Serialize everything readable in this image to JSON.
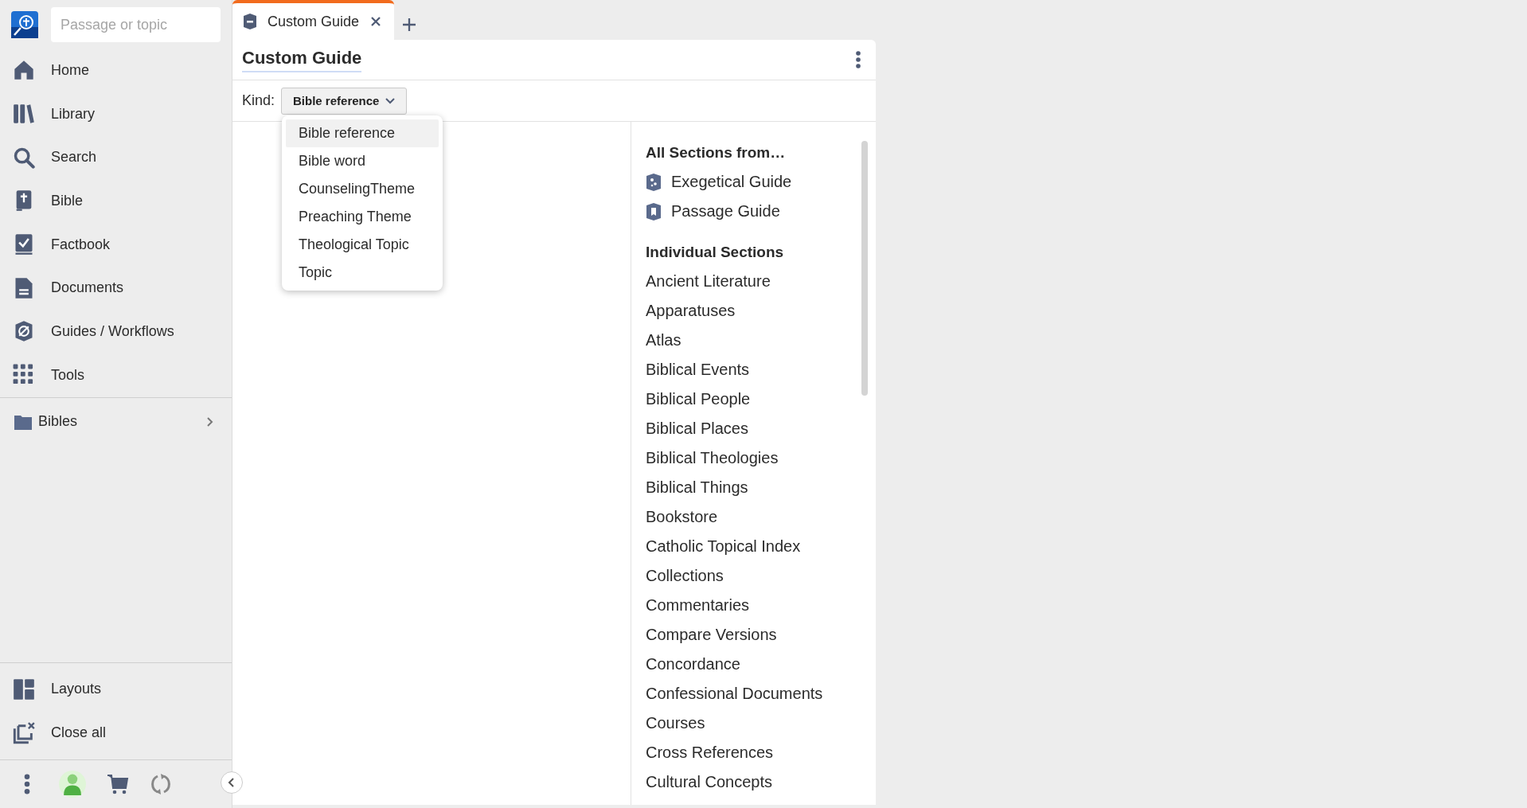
{
  "search": {
    "placeholder": "Passage or topic"
  },
  "nav": [
    {
      "label": "Home"
    },
    {
      "label": "Library"
    },
    {
      "label": "Search"
    },
    {
      "label": "Bible"
    },
    {
      "label": "Factbook"
    },
    {
      "label": "Documents"
    },
    {
      "label": "Guides / Workflows"
    },
    {
      "label": "Tools"
    }
  ],
  "folders": [
    {
      "label": "Bibles"
    }
  ],
  "bottom_nav": [
    {
      "label": "Layouts"
    },
    {
      "label": "Close all"
    }
  ],
  "tabs": [
    {
      "label": "Custom Guide",
      "selected": true
    }
  ],
  "panel": {
    "title": "Custom Guide",
    "kind_label": "Kind:",
    "kind_value": "Bible reference",
    "dropdown_expanded": true,
    "options": [
      {
        "label": "Bible reference",
        "selected": true
      },
      {
        "label": "Bible word",
        "selected": false
      },
      {
        "label": "CounselingTheme",
        "selected": false
      },
      {
        "label": "Preaching Theme",
        "selected": false
      },
      {
        "label": "Theological Topic",
        "selected": false
      },
      {
        "label": "Topic",
        "selected": false
      }
    ]
  },
  "sections": {
    "guides_heading": "All Sections from…",
    "guides": [
      "Exegetical Guide",
      "Passage Guide"
    ],
    "individual_heading": "Individual Sections",
    "items": [
      "Ancient Literature",
      "Apparatuses",
      "Atlas",
      "Biblical Events",
      "Biblical People",
      "Biblical Places",
      "Biblical Theologies",
      "Biblical Things",
      "Bookstore",
      "Catholic Topical Index",
      "Collections",
      "Commentaries",
      "Compare Versions",
      "Concordance",
      "Confessional Documents",
      "Courses",
      "Cross References",
      "Cultural Concepts"
    ]
  }
}
